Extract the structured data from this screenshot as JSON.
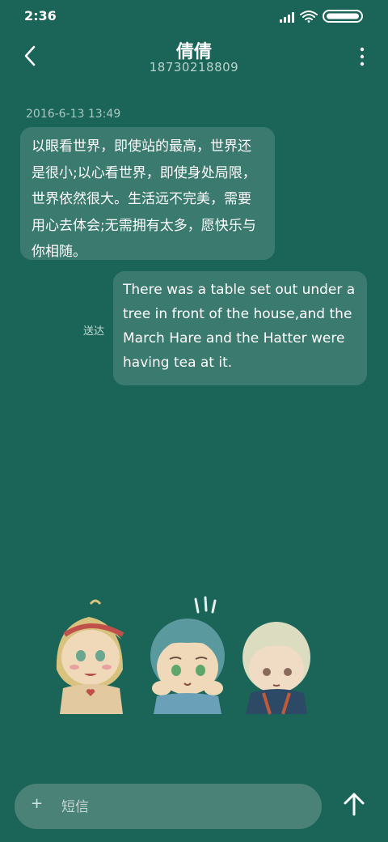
{
  "status_bar": {
    "time": "2:36",
    "icons": [
      "signal-icon",
      "wifi-icon",
      "battery-icon"
    ]
  },
  "header": {
    "contact_name": "倩倩",
    "contact_number": "18730218809",
    "icons": [
      "back-arrow-icon",
      "more-vertical-icon"
    ]
  },
  "conversation": {
    "timestamp": "2016-6-13 13:49",
    "incoming_message": "以眼看世界，即使站的最高，世界还是很小;以心看世界，即使身处局限，世界依然很大。生活远不完美，需要用心去体会;无需拥有太多，愿快乐与你相随。",
    "outgoing_message": "There was a table set out under a tree in front of the house,and the March Hare and the Hatter were having tea at it.",
    "delivery_status": "送达"
  },
  "composer": {
    "plus": "+",
    "placeholder": "短信",
    "send_icon": "up-arrow-icon"
  },
  "colors": {
    "background": "#1b6558",
    "bubble": "#3a7a6f",
    "composer": "#4a8278",
    "secondary_text": "#a9c7c0"
  }
}
